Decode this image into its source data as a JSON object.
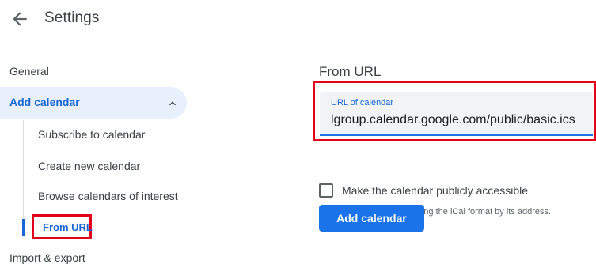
{
  "header": {
    "title": "Settings",
    "back_icon": "arrow-left-icon"
  },
  "sidebar": {
    "general_label": "General",
    "add_calendar": {
      "label": "Add calendar",
      "icon": "chevron-up-icon",
      "items": [
        {
          "label": "Subscribe to calendar"
        },
        {
          "label": "Create new calendar"
        },
        {
          "label": "Browse calendars of interest"
        },
        {
          "label": "From URL"
        }
      ]
    },
    "import_export_label": "Import & export"
  },
  "main": {
    "section_title": "From URL",
    "url_field": {
      "label": "URL of calendar",
      "value": "lgroup.calendar.google.com/public/basic.ics"
    },
    "public_checkbox": {
      "label": "Make the calendar publicly accessible",
      "checked": false
    },
    "helper_text": "You can add a calendar using the iCal format by its address.",
    "add_button_label": "Add calendar"
  },
  "colors": {
    "accent": "#1a73e8",
    "accent_text": "#1967d2",
    "active_bg": "#e8f0fe",
    "highlight": "#e2001a"
  }
}
